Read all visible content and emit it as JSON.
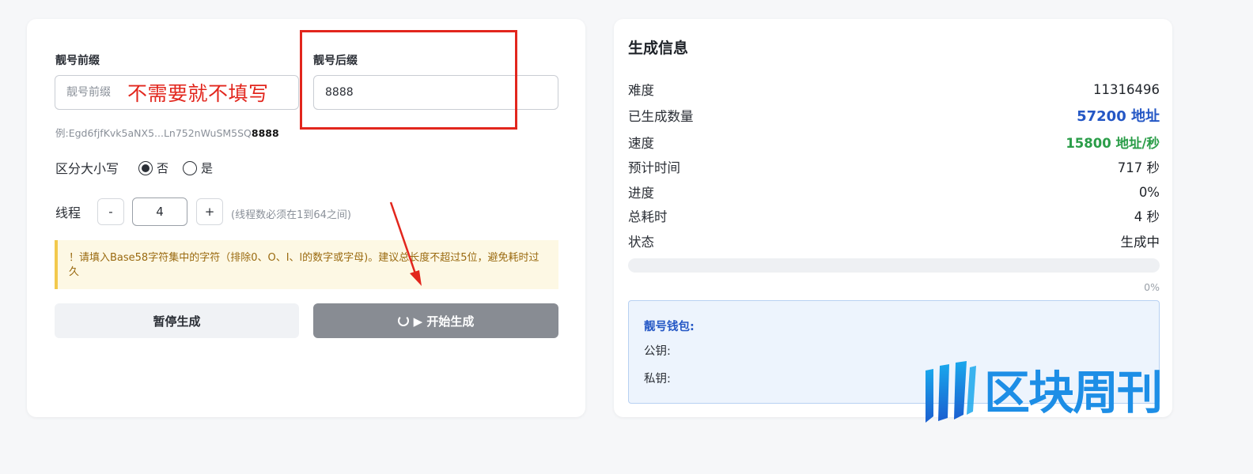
{
  "form": {
    "prefix_label": "靓号前缀",
    "prefix_placeholder": "靓号前缀",
    "prefix_value": "",
    "prefix_annotation": "不需要就不填写",
    "suffix_label": "靓号后缀",
    "suffix_value": "8888",
    "example_text": "例:Egd6fjfKvk5aNX5...Ln752nWuSM5SQ",
    "example_highlight": "8888",
    "case_label": "区分大小写",
    "case_options": [
      "否",
      "是"
    ],
    "case_selected": "否",
    "threads_label": "线程",
    "threads_minus": "-",
    "threads_value": "4",
    "threads_plus": "+",
    "threads_hint": "(线程数必须在1到64之间)",
    "warning": "！请填入Base58字符集中的字符（排除0、O、I、l的数字或字母)。建议总长度不超过5位，避免耗时过久",
    "pause_button": "暂停生成",
    "start_button": "▶ 开始生成"
  },
  "info": {
    "title": "生成信息",
    "stats": [
      {
        "label": "难度",
        "value": "11316496",
        "style": "plain"
      },
      {
        "label": "已生成数量",
        "value": "57200 地址",
        "style": "blue"
      },
      {
        "label": "速度",
        "value": "15800 地址/秒",
        "style": "green"
      },
      {
        "label": "预计时间",
        "value": "717 秒",
        "style": "plain"
      },
      {
        "label": "进度",
        "value": "0%",
        "style": "plain"
      },
      {
        "label": "总耗时",
        "value": "4 秒",
        "style": "plain"
      },
      {
        "label": "状态",
        "value": "生成中",
        "style": "plain"
      }
    ],
    "progress_percent_text": "0%",
    "progress_fraction": 0,
    "wallet_title": "靓号钱包:",
    "wallet_public_label": "公钥:",
    "wallet_private_label": "私钥:"
  },
  "watermark": {
    "text": "区块周刊"
  },
  "colors": {
    "accent_blue": "#2457c5",
    "accent_green": "#2a9d48",
    "annotation_red": "#e2261d",
    "warning_text": "#9a6a10"
  }
}
